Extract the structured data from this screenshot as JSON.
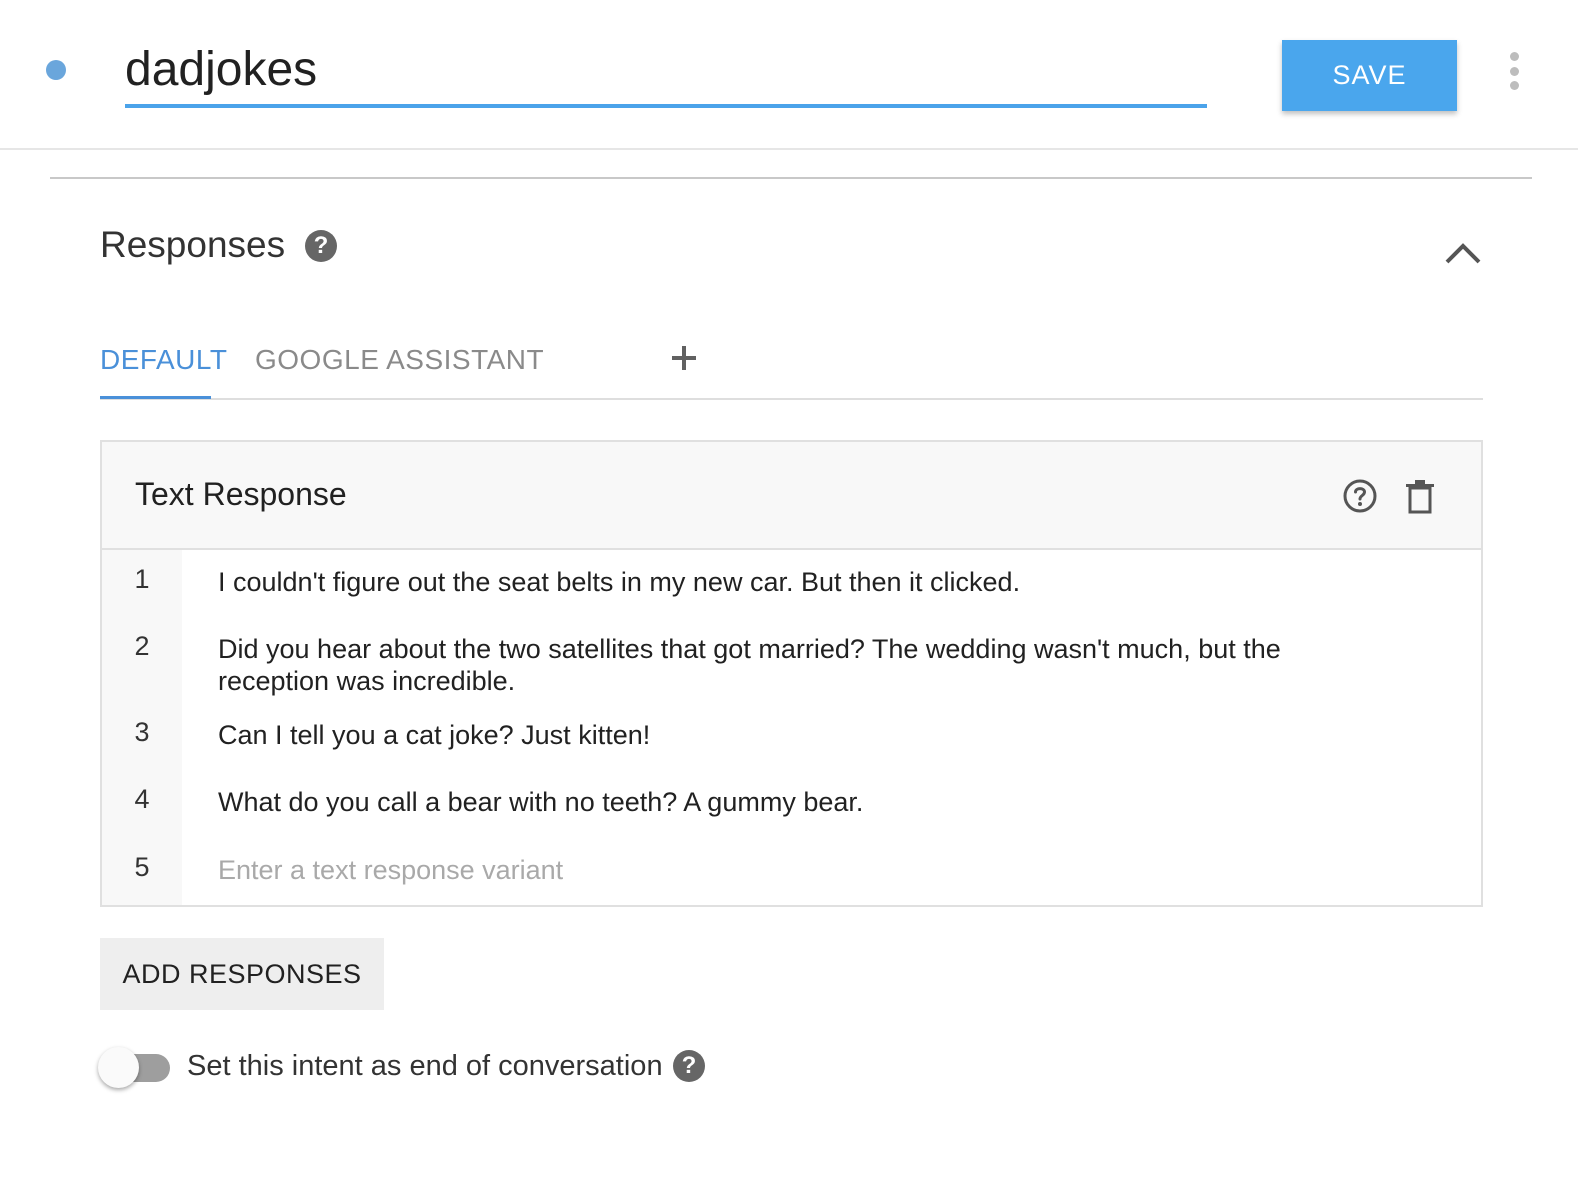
{
  "header": {
    "intent_name": "dadjokes",
    "save_label": "SAVE",
    "status_dot_color": "#6aa6dc",
    "accent_color": "#4aa6ed",
    "more_icon": "more-vert-icon"
  },
  "responses": {
    "title": "Responses",
    "help_icon": "help-icon",
    "collapse_icon": "chevron-up-icon",
    "tabs": [
      {
        "label": "DEFAULT",
        "active": true
      },
      {
        "label": "GOOGLE ASSISTANT",
        "active": false
      }
    ],
    "add_tab_icon": "plus-icon",
    "card": {
      "title": "Text Response",
      "help_icon": "help-outline-icon",
      "delete_icon": "trash-icon",
      "rows": [
        {
          "number": "1",
          "text": "I couldn't figure out the seat belts in my new car. But then it clicked."
        },
        {
          "number": "2",
          "text": "Did you hear about the two satellites that got married? The wedding wasn't much, but the reception was incredible."
        },
        {
          "number": "3",
          "text": "Can I tell you a cat joke? Just kitten!"
        },
        {
          "number": "4",
          "text": "What do you call a bear with no teeth? A gummy bear."
        },
        {
          "number": "5",
          "text": "",
          "placeholder": "Enter a text response variant"
        }
      ]
    },
    "add_responses_label": "ADD RESPONSES",
    "end_conversation": {
      "label": "Set this intent as end of conversation",
      "enabled": false,
      "help_icon": "help-icon"
    }
  }
}
